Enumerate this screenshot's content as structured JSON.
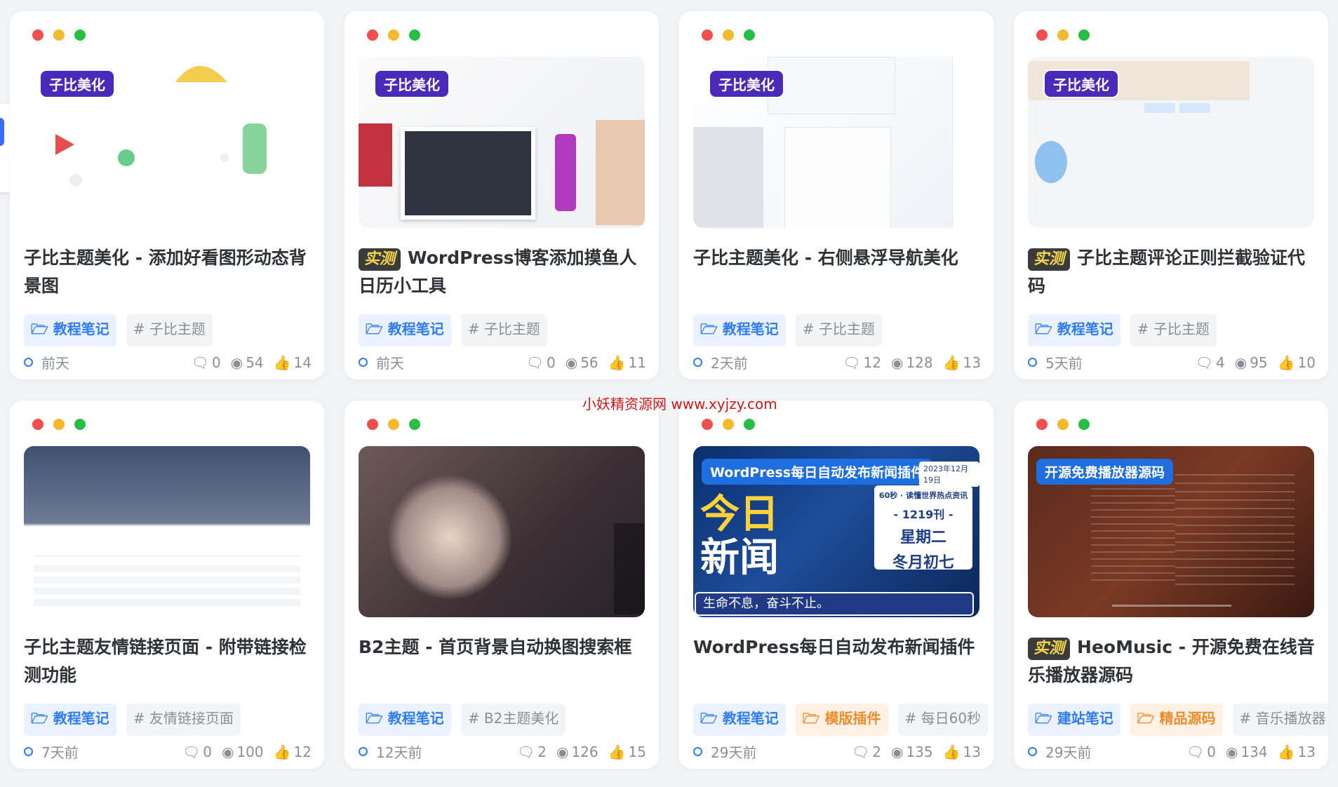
{
  "watermark": "小妖精资源网 www.xyjzy.com",
  "cards": [
    {
      "badge": "子比美化",
      "title": "子比主题美化 - 添加好看图形动态背景图",
      "tested": "",
      "tags": [
        {
          "label": "教程笔记",
          "type": "blue"
        },
        {
          "label": "# 子比主题",
          "type": "grey"
        }
      ],
      "time": "前天",
      "comments": "0",
      "views": "54",
      "likes": "14"
    },
    {
      "badge": "子比美化",
      "title": "WordPress博客添加摸鱼人日历小工具",
      "tested": "实测",
      "tags": [
        {
          "label": "教程笔记",
          "type": "blue"
        },
        {
          "label": "# 子比主题",
          "type": "grey"
        }
      ],
      "time": "前天",
      "comments": "0",
      "views": "56",
      "likes": "11"
    },
    {
      "badge": "子比美化",
      "title": "子比主题美化 - 右侧悬浮导航美化",
      "tested": "",
      "tags": [
        {
          "label": "教程笔记",
          "type": "blue"
        },
        {
          "label": "# 子比主题",
          "type": "grey"
        }
      ],
      "time": "2天前",
      "comments": "12",
      "views": "128",
      "likes": "13"
    },
    {
      "badge": "子比美化",
      "title": "子比主题评论正则拦截验证代码",
      "tested": "实测",
      "tags": [
        {
          "label": "教程笔记",
          "type": "blue"
        },
        {
          "label": "# 子比主题",
          "type": "grey"
        }
      ],
      "time": "5天前",
      "comments": "4",
      "views": "95",
      "likes": "10"
    },
    {
      "badge": "",
      "title": "子比主题友情链接页面 - 附带链接检测功能",
      "tested": "",
      "tags": [
        {
          "label": "教程笔记",
          "type": "blue"
        },
        {
          "label": "# 友情链接页面",
          "type": "grey"
        }
      ],
      "time": "7天前",
      "comments": "0",
      "views": "100",
      "likes": "12"
    },
    {
      "badge": "",
      "title": "B2主题 - 首页背景自动换图搜索框",
      "tested": "",
      "tags": [
        {
          "label": "教程笔记",
          "type": "blue"
        },
        {
          "label": "# B2主题美化",
          "type": "grey"
        }
      ],
      "time": "12天前",
      "comments": "2",
      "views": "126",
      "likes": "15"
    },
    {
      "badge": "WordPress每日自动发布新闻插件",
      "title": "WordPress每日自动发布新闻插件",
      "tested": "",
      "tags": [
        {
          "label": "教程笔记",
          "type": "blue"
        },
        {
          "label": "模版插件",
          "type": "orange"
        },
        {
          "label": "# 每日60秒",
          "type": "grey"
        }
      ],
      "time": "29天前",
      "comments": "2",
      "views": "135",
      "likes": "13",
      "thumb_text": {
        "big1": "今日",
        "big2": "新闻",
        "date": "2023年12月19日",
        "line1": "60秒 · 读懂世界热点资讯",
        "line2": "- 1219刊 -",
        "line3": "星期二",
        "line4": "冬月初七",
        "footer": "生命不息，奋斗不止。"
      }
    },
    {
      "badge": "开源免费播放器源码",
      "title": "HeoMusic - 开源免费在线音乐播放器源码",
      "tested": "实测",
      "tags": [
        {
          "label": "建站笔记",
          "type": "blue"
        },
        {
          "label": "精品源码",
          "type": "orange"
        },
        {
          "label": "# 音乐播放器",
          "type": "grey"
        }
      ],
      "time": "29天前",
      "comments": "0",
      "views": "134",
      "likes": "13"
    }
  ]
}
